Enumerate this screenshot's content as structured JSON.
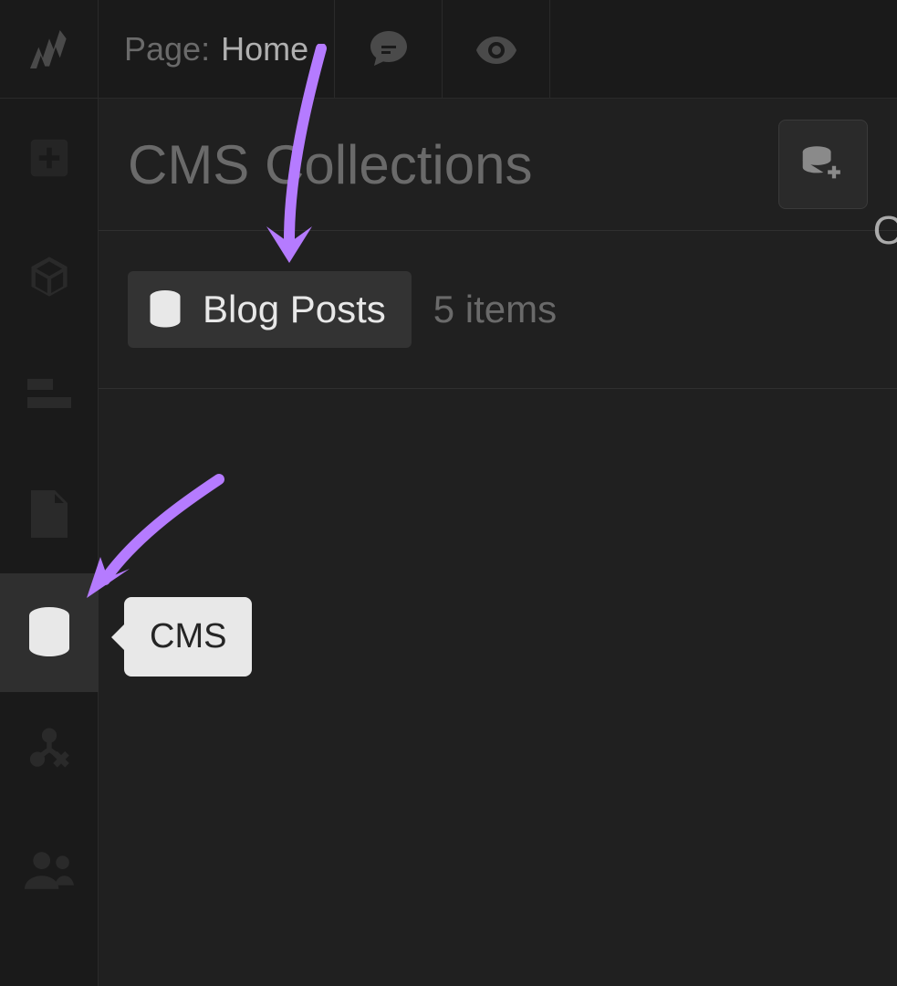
{
  "topbar": {
    "page_label": "Page:",
    "page_value": "Home"
  },
  "panel": {
    "title": "CMS Collections"
  },
  "collections": [
    {
      "name": "Blog Posts",
      "count_label": "5 items"
    }
  ],
  "tooltip": {
    "label": "CMS"
  },
  "icons": {
    "logo": "webflow-logo",
    "comment": "comment-icon",
    "preview": "eye-icon",
    "add": "add-icon",
    "components": "cube-icon",
    "navigator": "layout-icon",
    "pages": "page-icon",
    "cms": "database-icon",
    "logic": "logic-icon",
    "users": "users-icon",
    "add_collection": "database-plus-icon"
  },
  "edge_text": "O",
  "colors": {
    "arrow": "#b57bff"
  }
}
